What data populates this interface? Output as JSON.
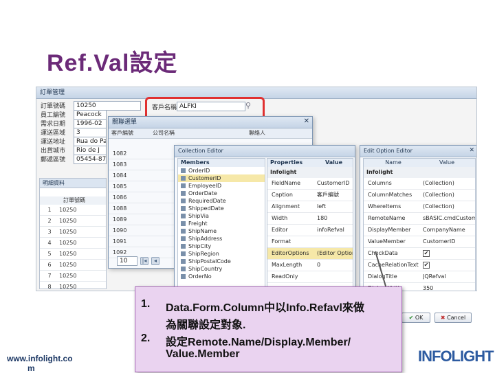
{
  "slide": {
    "title": "Ref.Val設定",
    "footer_url_line1": "www.infolight.co",
    "footer_url_line2": "m",
    "logo_text": "INFOLIGHT",
    "accent_color": "#6b2a78",
    "highlight_color": "#e03030"
  },
  "main_window": {
    "title": "訂單管理",
    "fields": [
      {
        "label": "訂單號碼",
        "value": "10250"
      },
      {
        "label": "員工編號",
        "value": "Peacock"
      },
      {
        "label": "需求日期",
        "value": "1996-02"
      },
      {
        "label": "運送區域",
        "value": "3"
      },
      {
        "label": "運送地址",
        "value": "Rua do Paço"
      },
      {
        "label": "出貨城市",
        "value": "Rio de J"
      },
      {
        "label": "郵遞區號",
        "value": "05454-876"
      }
    ],
    "customer_label": "客戶名稱",
    "customer_value": "ALFKI",
    "detail_tab": "明細資料",
    "detail_header": "訂單號碼",
    "detail_rows": [
      {
        "n": "1",
        "v": "10250"
      },
      {
        "n": "2",
        "v": "10250"
      },
      {
        "n": "3",
        "v": "10250"
      },
      {
        "n": "4",
        "v": "10250"
      },
      {
        "n": "5",
        "v": "10250"
      },
      {
        "n": "6",
        "v": "10250"
      },
      {
        "n": "7",
        "v": "10250"
      },
      {
        "n": "8",
        "v": "10250"
      },
      {
        "n": "9",
        "v": "10250"
      }
    ]
  },
  "lookup_dialog": {
    "title": "關聯選單",
    "col1": "客戶編號",
    "col2": "公司名稱",
    "col3": "聯絡人",
    "rows": [
      "1082",
      "1083",
      "1084",
      "1085",
      "1086",
      "1088",
      "1089",
      "1090",
      "1091",
      "1092"
    ],
    "pager_value": "10"
  },
  "collection_editor": {
    "title": "Collection Editor",
    "members_header": "Members",
    "properties_header": "Properties",
    "value_header": "Value",
    "members": [
      "OrderID",
      "CustomerID",
      "EmployeeID",
      "OrderDate",
      "RequiredDate",
      "ShippedDate",
      "ShipVia",
      "Freight",
      "ShipName",
      "ShipAddress",
      "ShipCity",
      "ShipRegion",
      "ShipPostalCode",
      "ShipCountry",
      "OrderNo"
    ],
    "selected_member": "CustomerID",
    "group": "Infolight",
    "properties": [
      {
        "name": "FieldName",
        "value": "CustomerID"
      },
      {
        "name": "Caption",
        "value": "客戶編號"
      },
      {
        "name": "Alignment",
        "value": "left"
      },
      {
        "name": "Width",
        "value": "180"
      },
      {
        "name": "Editor",
        "value": "infoRefval"
      },
      {
        "name": "Format",
        "value": ""
      },
      {
        "name": "EditorOptions",
        "value": "(Editor Options)"
      },
      {
        "name": "MaxLength",
        "value": "0"
      },
      {
        "name": "ReadOnly",
        "value": ""
      }
    ]
  },
  "option_editor": {
    "title": "Edit Option Editor",
    "col_name": "Name",
    "col_value": "Value",
    "group": "Infolight",
    "rows": [
      {
        "name": "Columns",
        "value": "(Collection)"
      },
      {
        "name": "ColumnMatches",
        "value": "(Collection)"
      },
      {
        "name": "WhereItems",
        "value": "(Collection)"
      },
      {
        "name": "RemoteName",
        "value": "sBASIC.cmdCustomers"
      },
      {
        "name": "DisplayMember",
        "value": "CompanyName"
      },
      {
        "name": "ValueMember",
        "value": "CustomerID"
      },
      {
        "name": "CheckData",
        "value": "✔"
      },
      {
        "name": "CacheRelationText",
        "value": "✔"
      },
      {
        "name": "DialogTitle",
        "value": "JQRefval"
      },
      {
        "name": "DialogWidth",
        "value": "350"
      }
    ],
    "ok_label": "OK",
    "cancel_label": "Cancel"
  },
  "note": {
    "item1_num": "1.",
    "item1_line1": "Data.Form.Column中以Info.Refavl來做",
    "item1_line2": "為關聯設定對象.",
    "item2_num": "2.",
    "item2_line1": "設定Remote.Name/Display.Member/",
    "item2_line2": "Value.Member"
  }
}
